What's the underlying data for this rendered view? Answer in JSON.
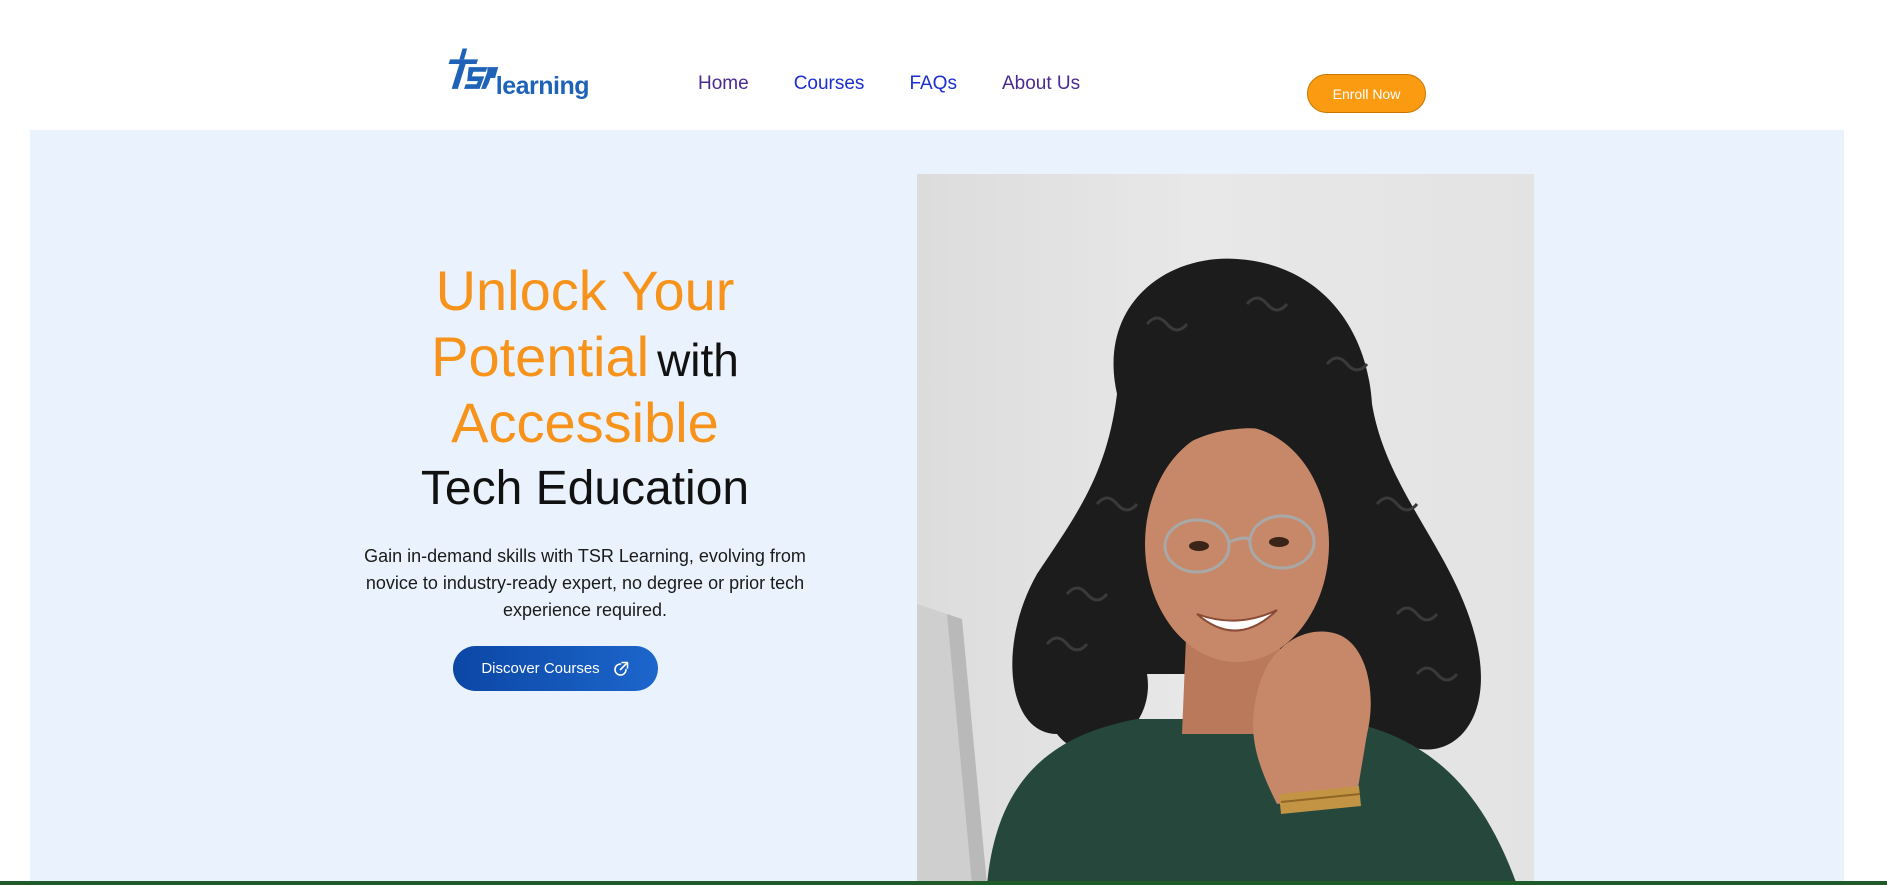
{
  "header": {
    "logo_text": "learning",
    "logo_mark_text": "TSR",
    "nav": [
      {
        "label": "Home"
      },
      {
        "label": "Courses"
      },
      {
        "label": "FAQs"
      },
      {
        "label": "About Us"
      }
    ],
    "cta_label": "Enroll Now"
  },
  "hero": {
    "headline": {
      "line1": "Unlock Your",
      "line2_orange": "Potential",
      "line2_dark": "with",
      "line3": "Accessible",
      "line4": "Tech Education"
    },
    "subtext": "Gain in-demand skills with TSR Learning, evolving from novice to industry-ready expert, no degree or prior tech experience required.",
    "button_label": "Discover Courses",
    "button_icon": "external-link-icon"
  },
  "colors": {
    "accent_orange": "#f7931a",
    "button_orange": "#fb9b12",
    "brand_blue": "#1e63b8",
    "hero_bg": "#eaf3fd"
  }
}
